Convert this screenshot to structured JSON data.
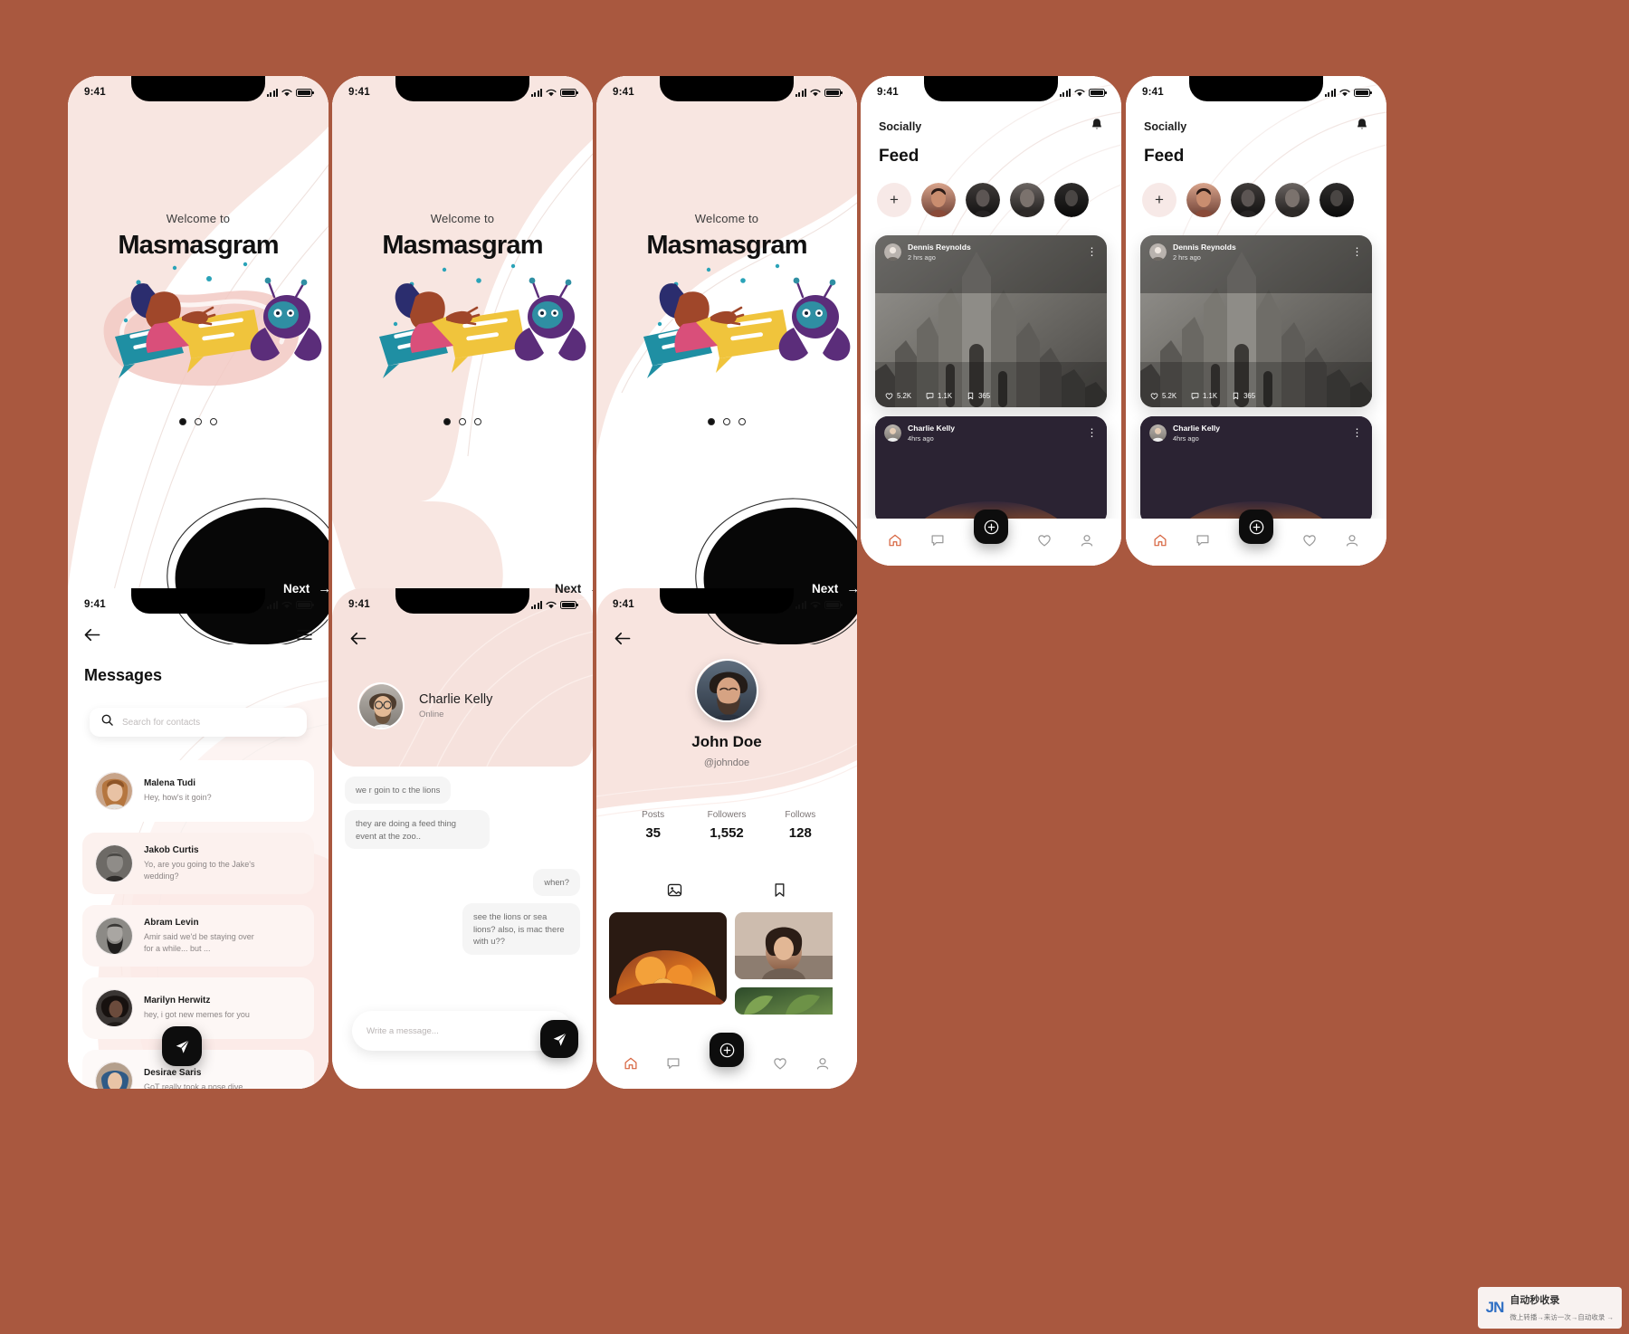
{
  "meta": {
    "bg_color": "#a9583f",
    "accent": "#d7643f",
    "blush": "#f7e2dd",
    "dark": "#0d0d0d"
  },
  "status_bar": {
    "time": "9:41",
    "signal_icon": "signal-bars-icon",
    "wifi_icon": "wifi-icon",
    "battery_icon": "battery-icon"
  },
  "onboarding": {
    "welcome": "Welcome to",
    "title": "Masmasgram",
    "next_label": "Next",
    "next_arrow": "→",
    "dots": [
      true,
      false,
      false
    ],
    "screens": [
      {
        "variant": "blob-right-pink",
        "next_style": "dark-bottom-right"
      },
      {
        "variant": "blob-left-pink",
        "next_style": "light-bottom-left"
      },
      {
        "variant": "blob-top-pink",
        "next_style": "dark-bottom-right"
      }
    ]
  },
  "feed": {
    "brand": "Socially",
    "bell_icon": "bell-icon",
    "title": "Feed",
    "story_add_icon": "plus-icon",
    "stories": [
      "story-1",
      "story-2",
      "story-3",
      "story-4"
    ],
    "posts": [
      {
        "author": "Dennis Reynolds",
        "time": "2 hrs ago",
        "more_icon": "more-vertical-icon",
        "image": "concrete-church-photo",
        "actions": [
          {
            "icon": "heart-icon",
            "count": "5.2K"
          },
          {
            "icon": "comment-icon",
            "count": "1.1K"
          },
          {
            "icon": "bookmark-icon",
            "count": "365"
          }
        ]
      },
      {
        "author": "Charlie Kelly",
        "time": "4hrs ago",
        "more_icon": "more-vertical-icon",
        "image": "dark-fire-photo",
        "actions": []
      }
    ],
    "tabs": [
      {
        "name": "home",
        "icon": "home-icon",
        "active": true
      },
      {
        "name": "messages",
        "icon": "chat-icon",
        "active": false
      },
      {
        "name": "likes",
        "icon": "heart-icon",
        "active": false
      },
      {
        "name": "profile",
        "icon": "person-icon",
        "active": false
      }
    ],
    "fab_icon": "plus-circle-icon"
  },
  "messages": {
    "back_icon": "arrow-left-icon",
    "menu_icon": "hamburger-menu-icon",
    "title": "Messages",
    "search": {
      "icon": "search-icon",
      "placeholder": "Search for contacts",
      "value": ""
    },
    "compose_icon": "send-icon",
    "contacts": [
      {
        "name": "Malena Tudi",
        "preview": "Hey, how's it goin?",
        "avatar": "malena-avatar",
        "tint": "#ffffff"
      },
      {
        "name": "Jakob Curtis",
        "preview": "Yo, are you going to the Jake's wedding?",
        "avatar": "jakob-avatar",
        "tint": "#fcf3f1"
      },
      {
        "name": "Abram Levin",
        "preview": "Amir said we'd be staying over for a while... but ...",
        "avatar": "abram-avatar",
        "tint": "#fdf6f4"
      },
      {
        "name": "Marilyn Herwitz",
        "preview": "hey, i got new memes for you",
        "avatar": "marilyn-avatar",
        "tint": "#fdf8f6"
      },
      {
        "name": "Desirae Saris",
        "preview": "GoT really took a nose dive",
        "avatar": "desirae-avatar",
        "tint": "#fdf9f8"
      }
    ]
  },
  "chat": {
    "back_icon": "arrow-left-icon",
    "contact_name": "Charlie Kelly",
    "contact_status": "Online",
    "avatar": "charlie-avatar",
    "bubbles": [
      {
        "from": "them",
        "text": "we r goin to c the lions"
      },
      {
        "from": "them",
        "text": "they are doing a feed thing event at the zoo.."
      },
      {
        "from": "me",
        "text": "when?"
      },
      {
        "from": "me",
        "text": "see the lions or sea lions? also, is mac there with u??"
      }
    ],
    "composer": {
      "placeholder": "Write a message...",
      "value": "",
      "send_icon": "send-icon"
    }
  },
  "profile": {
    "back_icon": "arrow-left-icon",
    "avatar": "john-doe-avatar",
    "name": "John Doe",
    "handle": "@johndoe",
    "stats": [
      {
        "label": "Posts",
        "value": "35"
      },
      {
        "label": "Followers",
        "value": "1,552"
      },
      {
        "label": "Follows",
        "value": "128"
      }
    ],
    "tabs": [
      {
        "name": "grid",
        "icon": "image-icon",
        "active": true
      },
      {
        "name": "saved",
        "icon": "bookmark-icon",
        "active": false
      }
    ],
    "grid_images": [
      "food-oranges-photo",
      "woman-portrait-photo",
      "plant-leaves-photo"
    ],
    "tabs_bottom": [
      {
        "name": "home",
        "icon": "home-icon",
        "active": true
      },
      {
        "name": "messages",
        "icon": "chat-icon",
        "active": false
      },
      {
        "name": "likes",
        "icon": "heart-icon",
        "active": false
      },
      {
        "name": "profile",
        "icon": "person-icon",
        "active": false
      }
    ],
    "fab_icon": "plus-circle-icon"
  },
  "watermark": {
    "logo": "JN",
    "line1": "自动秒收录",
    "line2": "微上转播→来访一次→自动收录 →"
  }
}
